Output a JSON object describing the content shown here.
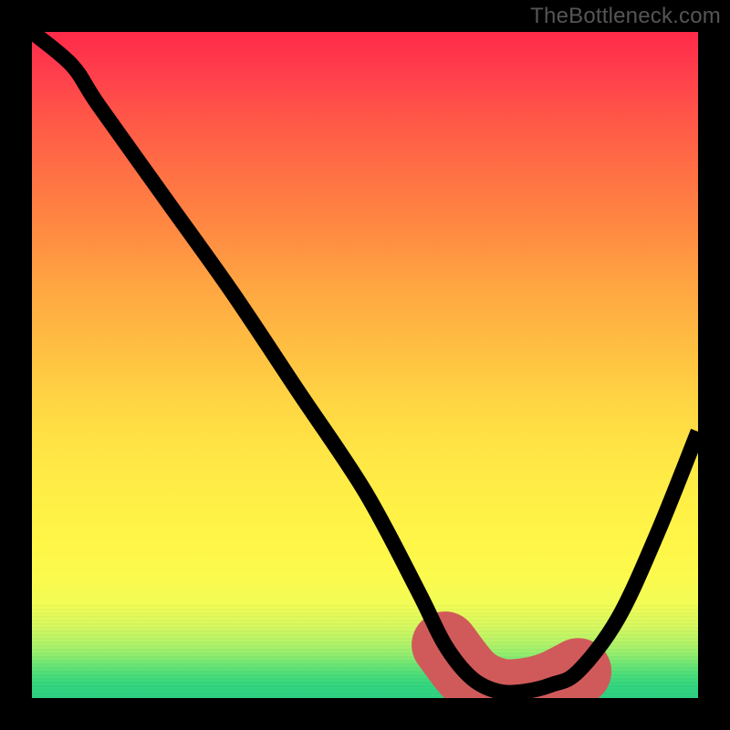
{
  "watermark": "TheBottleneck.com",
  "chart_data": {
    "type": "line",
    "title": "",
    "xlabel": "",
    "ylabel": "",
    "xlim": [
      0,
      100
    ],
    "ylim": [
      0,
      100
    ],
    "grid": false,
    "legend": false,
    "series": [
      {
        "name": "bottleneck-curve",
        "x": [
          0,
          6,
          10,
          20,
          30,
          40,
          50,
          58,
          62,
          66,
          70,
          74,
          78,
          82,
          88,
          94,
          100
        ],
        "values": [
          100,
          95,
          89,
          75,
          61,
          46,
          31,
          16,
          8,
          3,
          1,
          1,
          2,
          4,
          12,
          25,
          40
        ]
      }
    ],
    "highlight_range_x": [
      65,
      80
    ],
    "colors": {
      "curve": "#000000",
      "highlight": "#d05a5a",
      "bg_top": "#ff2a4a",
      "bg_bottom": "#2ed183"
    }
  }
}
